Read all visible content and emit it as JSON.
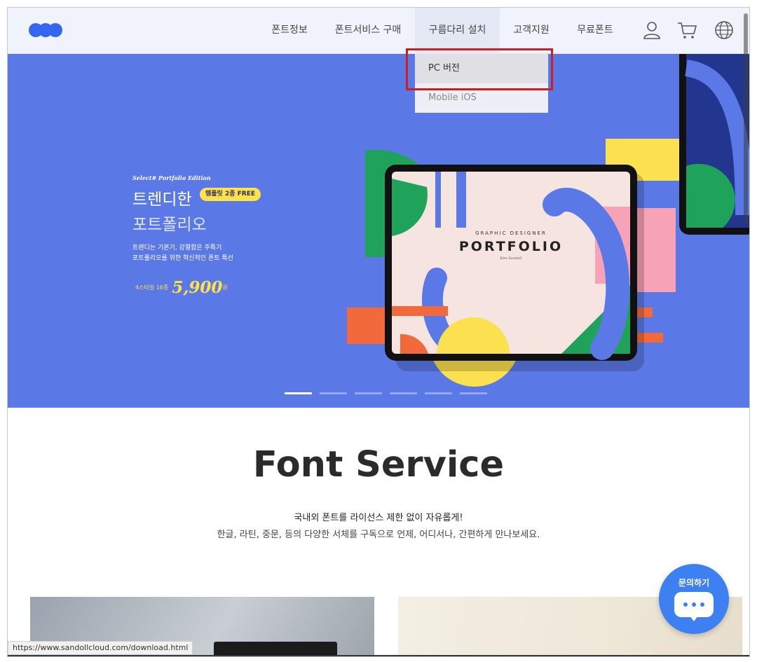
{
  "header": {
    "logo_name": "three-dot-logo",
    "nav": [
      {
        "label": "폰트정보"
      },
      {
        "label": "폰트서비스 구매"
      },
      {
        "label": "구름다리 설치"
      },
      {
        "label": "고객지원"
      },
      {
        "label": "무료폰트"
      }
    ],
    "icons": [
      "user-icon",
      "cart-icon",
      "globe-icon"
    ]
  },
  "dropdown": {
    "items": [
      {
        "label": "PC 버전"
      },
      {
        "label": "Mobile iOS"
      }
    ]
  },
  "hero": {
    "eyebrow": "Select# Portfolio Edition",
    "title1": "트렌디한",
    "title2": "포트폴리오",
    "badge": "템플릿 2종 FREE",
    "desc1": "트렌디는 기본기, 강렬함은 주특기",
    "desc2": "포트폴리오를 위한 혁신적인 폰트 특선",
    "price_label": "4스타일 16종",
    "price_value": "5,900",
    "price_unit": "원",
    "tablet": {
      "caption": "GRAPHIC DESIGNER",
      "title": "PORTFOLIO",
      "signature": "Kim Sandoll"
    },
    "slides_total": 6,
    "slide_active": 1
  },
  "section": {
    "title": "Font Service",
    "sub1": "국내외 폰트를 라이선스 제한 없이 자유롭게!",
    "sub2": "한글, 라틴, 중문, 등의 다양한 서체를 구독으로 언제, 어디서나, 간편하게 만나보세요."
  },
  "status_url": "https://www.sandollcloud.com/download.html",
  "chat": {
    "label": "문의하기"
  },
  "colors": {
    "brand": "#3466f0",
    "hero_bg": "#5b79e6",
    "badge": "#ffe24a",
    "highlight": "#d41c1c",
    "chat": "#3d80f2"
  }
}
